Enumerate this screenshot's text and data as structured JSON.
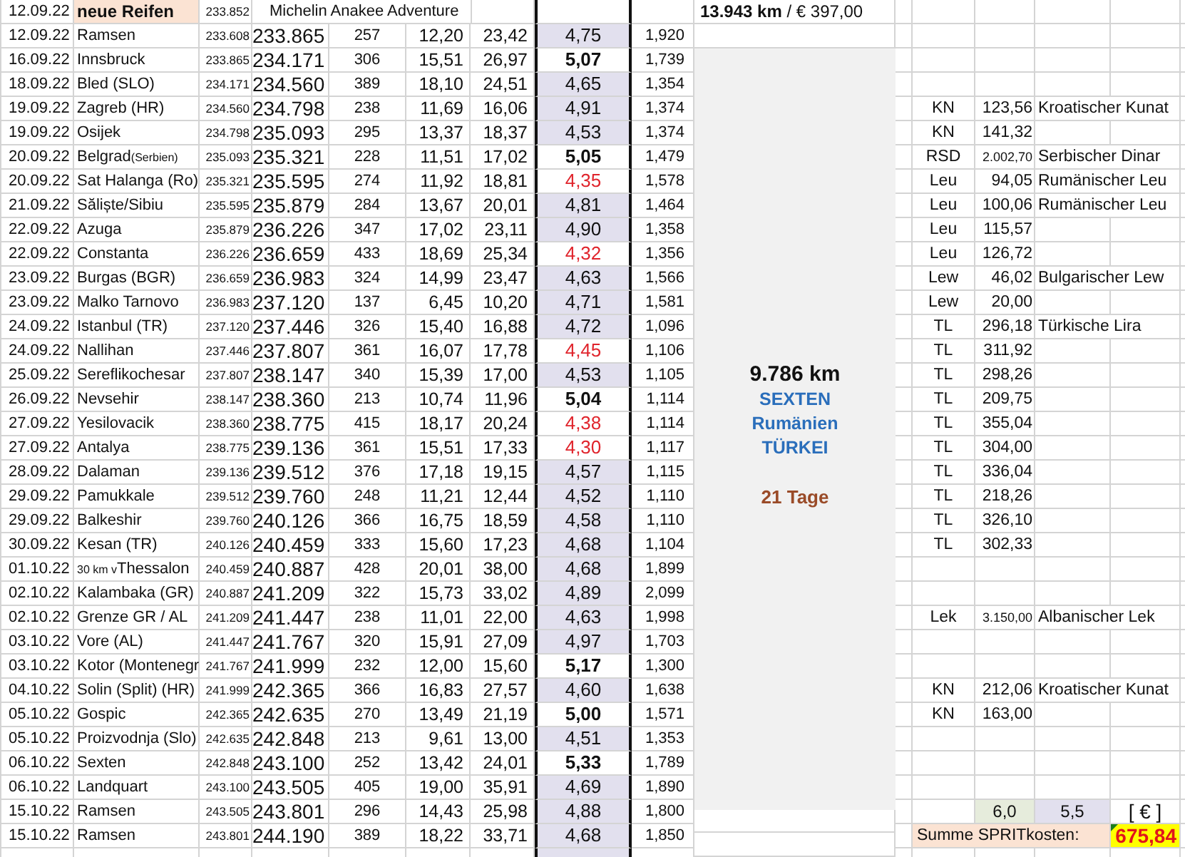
{
  "tyre_row": {
    "date": "12.09.22",
    "label": "neue Reifen",
    "odometer": "233.852",
    "note": "Michelin Anakee Adventure"
  },
  "rows": [
    {
      "date": "12.09.22",
      "place": "Ramsen",
      "start": "233.608",
      "odometer": "233.865",
      "km": "257",
      "liters": "12,20",
      "euro": "23,42",
      "consumption": "4,75",
      "kind": "normal",
      "price": "1,920"
    },
    {
      "date": "16.09.22",
      "place": "Innsbruck",
      "start": "233.865",
      "odometer": "234.171",
      "km": "306",
      "liters": "15,51",
      "euro": "26,97",
      "consumption": "5,07",
      "kind": "high",
      "price": "1,739"
    },
    {
      "date": "18.09.22",
      "place": "Bled  (SLO)",
      "start": "234.171",
      "odometer": "234.560",
      "km": "389",
      "liters": "18,10",
      "euro": "24,51",
      "consumption": "4,65",
      "kind": "normal",
      "price": "1,354"
    },
    {
      "date": "19.09.22",
      "place": "Zagreb  (HR)",
      "start": "234.560",
      "odometer": "234.798",
      "km": "238",
      "liters": "11,69",
      "euro": "16,06",
      "consumption": "4,91",
      "kind": "normal",
      "price": "1,374",
      "currency": {
        "code": "KN",
        "amount": "123,56",
        "name": "Kroatischer Kunat"
      }
    },
    {
      "date": "19.09.22",
      "place": "Osijek",
      "start": "234.798",
      "odometer": "235.093",
      "km": "295",
      "liters": "13,37",
      "euro": "18,37",
      "consumption": "4,53",
      "kind": "normal",
      "price": "1,374",
      "currency": {
        "code": "KN",
        "amount": "141,32"
      }
    },
    {
      "date": "20.09.22",
      "place": "Belgrad",
      "suffix": "(Serbien)",
      "start": "235.093",
      "odometer": "235.321",
      "km": "228",
      "liters": "11,51",
      "euro": "17,02",
      "consumption": "5,05",
      "kind": "high",
      "price": "1,479",
      "currency": {
        "code": "RSD",
        "amount": "2.002,70",
        "name": "Serbischer Dinar"
      }
    },
    {
      "date": "20.09.22",
      "place": "Sat Halanga (Ro)",
      "start": "235.321",
      "odometer": "235.595",
      "km": "274",
      "liters": "11,92",
      "euro": "18,81",
      "consumption": "4,35",
      "kind": "low",
      "price": "1,578",
      "currency": {
        "code": "Leu",
        "amount": "94,05",
        "name": "Rumänischer Leu"
      }
    },
    {
      "date": "21.09.22",
      "place": "Săliște/Sibiu",
      "start": "235.595",
      "odometer": "235.879",
      "km": "284",
      "liters": "13,67",
      "euro": "20,01",
      "consumption": "4,81",
      "kind": "normal",
      "price": "1,464",
      "currency": {
        "code": "Leu",
        "amount": "100,06",
        "name": "Rumänischer Leu"
      }
    },
    {
      "date": "22.09.22",
      "place": "Azuga",
      "start": "235.879",
      "odometer": "236.226",
      "km": "347",
      "liters": "17,02",
      "euro": "23,11",
      "consumption": "4,90",
      "kind": "normal",
      "price": "1,358",
      "currency": {
        "code": "Leu",
        "amount": "115,57"
      }
    },
    {
      "date": "22.09.22",
      "place": "Constanta",
      "start": "236.226",
      "odometer": "236.659",
      "km": "433",
      "liters": "18,69",
      "euro": "25,34",
      "consumption": "4,32",
      "kind": "low",
      "price": "1,356",
      "currency": {
        "code": "Leu",
        "amount": "126,72"
      }
    },
    {
      "date": "23.09.22",
      "place": "Burgas  (BGR)",
      "start": "236.659",
      "odometer": "236.983",
      "km": "324",
      "liters": "14,99",
      "euro": "23,47",
      "consumption": "4,63",
      "kind": "normal",
      "price": "1,566",
      "currency": {
        "code": "Lew",
        "amount": "46,02",
        "name": "Bulgarischer Lew"
      }
    },
    {
      "date": "23.09.22",
      "place": "Malko Tarnovo",
      "start": "236.983",
      "odometer": "237.120",
      "km": "137",
      "liters": "6,45",
      "euro": "10,20",
      "consumption": "4,71",
      "kind": "normal",
      "price": "1,581",
      "currency": {
        "code": "Lew",
        "amount": "20,00"
      }
    },
    {
      "date": "24.09.22",
      "place": "Istanbul (TR)",
      "start": "237.120",
      "odometer": "237.446",
      "km": "326",
      "liters": "15,40",
      "euro": "16,88",
      "consumption": "4,72",
      "kind": "normal",
      "price": "1,096",
      "currency": {
        "code": "TL",
        "amount": "296,18",
        "name": "Türkische Lira"
      }
    },
    {
      "date": "24.09.22",
      "place": "Nallihan",
      "start": "237.446",
      "odometer": "237.807",
      "km": "361",
      "liters": "16,07",
      "euro": "17,78",
      "consumption": "4,45",
      "kind": "low",
      "price": "1,106",
      "currency": {
        "code": "TL",
        "amount": "311,92"
      }
    },
    {
      "date": "25.09.22",
      "place": "Sereflikochesar",
      "start": "237.807",
      "odometer": "238.147",
      "km": "340",
      "liters": "15,39",
      "euro": "17,00",
      "consumption": "4,53",
      "kind": "normal",
      "price": "1,105",
      "currency": {
        "code": "TL",
        "amount": "298,26"
      }
    },
    {
      "date": "26.09.22",
      "place": "Nevsehir",
      "start": "238.147",
      "odometer": "238.360",
      "km": "213",
      "liters": "10,74",
      "euro": "11,96",
      "consumption": "5,04",
      "kind": "high",
      "price": "1,114",
      "currency": {
        "code": "TL",
        "amount": "209,75"
      }
    },
    {
      "date": "27.09.22",
      "place": "Yesilovacik",
      "start": "238.360",
      "odometer": "238.775",
      "km": "415",
      "liters": "18,17",
      "euro": "20,24",
      "consumption": "4,38",
      "kind": "low",
      "price": "1,114",
      "currency": {
        "code": "TL",
        "amount": "355,04"
      }
    },
    {
      "date": "27.09.22",
      "place": "Antalya",
      "start": "238.775",
      "odometer": "239.136",
      "km": "361",
      "liters": "15,51",
      "euro": "17,33",
      "consumption": "4,30",
      "kind": "low",
      "price": "1,117",
      "currency": {
        "code": "TL",
        "amount": "304,00"
      }
    },
    {
      "date": "28.09.22",
      "place": "Dalaman",
      "start": "239.136",
      "odometer": "239.512",
      "km": "376",
      "liters": "17,18",
      "euro": "19,15",
      "consumption": "4,57",
      "kind": "normal",
      "price": "1,115",
      "currency": {
        "code": "TL",
        "amount": "336,04"
      }
    },
    {
      "date": "29.09.22",
      "place": "Pamukkale",
      "start": "239.512",
      "odometer": "239.760",
      "km": "248",
      "liters": "11,21",
      "euro": "12,44",
      "consumption": "4,52",
      "kind": "normal",
      "price": "1,110",
      "currency": {
        "code": "TL",
        "amount": "218,26"
      }
    },
    {
      "date": "29.09.22",
      "place": "Balkeshir",
      "start": "239.760",
      "odometer": "240.126",
      "km": "366",
      "liters": "16,75",
      "euro": "18,59",
      "consumption": "4,58",
      "kind": "normal",
      "price": "1,110",
      "currency": {
        "code": "TL",
        "amount": "326,10"
      }
    },
    {
      "date": "30.09.22",
      "place": "Kesan  (TR)",
      "start": "240.126",
      "odometer": "240.459",
      "km": "333",
      "liters": "15,60",
      "euro": "17,23",
      "consumption": "4,68",
      "kind": "normal",
      "price": "1,104",
      "currency": {
        "code": "TL",
        "amount": "302,33"
      }
    },
    {
      "date": "01.10.22",
      "prefix": "30 km v",
      "place": "Thessalon",
      "start": "240.459",
      "odometer": "240.887",
      "km": "428",
      "liters": "20,01",
      "euro": "38,00",
      "consumption": "4,68",
      "kind": "normal",
      "price": "1,899"
    },
    {
      "date": "02.10.22",
      "place": "Kalambaka (GR)",
      "start": "240.887",
      "odometer": "241.209",
      "km": "322",
      "liters": "15,73",
      "euro": "33,02",
      "consumption": "4,89",
      "kind": "normal",
      "price": "2,099"
    },
    {
      "date": "02.10.22",
      "place": "Grenze GR / AL",
      "start": "241.209",
      "odometer": "241.447",
      "km": "238",
      "liters": "11,01",
      "euro": "22,00",
      "consumption": "4,63",
      "kind": "normal",
      "price": "1,998",
      "currency": {
        "code": "Lek",
        "amount": "3.150,00",
        "name": "Albanischer Lek"
      }
    },
    {
      "date": "03.10.22",
      "place": "Vore  (AL)",
      "start": "241.447",
      "odometer": "241.767",
      "km": "320",
      "liters": "15,91",
      "euro": "27,09",
      "consumption": "4,97",
      "kind": "normal",
      "price": "1,703"
    },
    {
      "date": "03.10.22",
      "place": "Kotor (Montenegr",
      "start": "241.767",
      "odometer": "241.999",
      "km": "232",
      "liters": "12,00",
      "euro": "15,60",
      "consumption": "5,17",
      "kind": "high",
      "price": "1,300"
    },
    {
      "date": "04.10.22",
      "place": "Solin (Split) (HR)",
      "start": "241.999",
      "odometer": "242.365",
      "km": "366",
      "liters": "16,83",
      "euro": "27,57",
      "consumption": "4,60",
      "kind": "normal",
      "price": "1,638",
      "currency": {
        "code": "KN",
        "amount": "212,06",
        "name": "Kroatischer Kunat"
      }
    },
    {
      "date": "05.10.22",
      "place": "Gospic",
      "start": "242.365",
      "odometer": "242.635",
      "km": "270",
      "liters": "13,49",
      "euro": "21,19",
      "consumption": "5,00",
      "kind": "high",
      "price": "1,571",
      "currency": {
        "code": "KN",
        "amount": "163,00"
      }
    },
    {
      "date": "05.10.22",
      "place": "Proizvodnja (Slo)",
      "start": "242.635",
      "odometer": "242.848",
      "km": "213",
      "liters": "9,61",
      "euro": "13,00",
      "consumption": "4,51",
      "kind": "normal",
      "price": "1,353"
    },
    {
      "date": "06.10.22",
      "place": "Sexten",
      "start": "242.848",
      "odometer": "243.100",
      "km": "252",
      "liters": "13,42",
      "euro": "24,01",
      "consumption": "5,33",
      "kind": "high",
      "price": "1,789"
    },
    {
      "date": "06.10.22",
      "place": "Landquart",
      "start": "243.100",
      "odometer": "243.505",
      "km": "405",
      "liters": "19,00",
      "euro": "35,91",
      "consumption": "4,69",
      "kind": "normal",
      "price": "1,890"
    },
    {
      "date": "15.10.22",
      "place": "Ramsen",
      "start": "243.505",
      "odometer": "243.801",
      "km": "296",
      "liters": "14,43",
      "euro": "25,98",
      "consumption": "4,88",
      "kind": "normal",
      "price": "1,800"
    },
    {
      "date": "15.10.22",
      "place": "Ramsen",
      "start": "243.801",
      "odometer": "244.190",
      "km": "389",
      "liters": "18,22",
      "euro": "33,71",
      "consumption": "4,68",
      "kind": "normal",
      "price": "1,850"
    }
  ],
  "total": "**13.943 km** / € 397,00",
  "panel": {
    "distance": "9.786 km",
    "lines": [
      "SEXTEN",
      "Rumänien",
      "TÜRKEI"
    ],
    "duration": "21 Tage"
  },
  "fuel_summary": {
    "value_a": "6,0",
    "value_b": "5,5",
    "unit": "[ € ]",
    "label": "Summe SPRITkosten:",
    "total": "675,84"
  }
}
